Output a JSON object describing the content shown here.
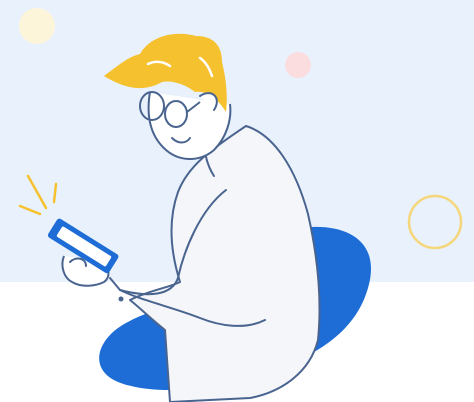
{
  "illustration": {
    "subject": "person-using-phone",
    "colors": {
      "sky": "#E8F1FC",
      "ground": "#FFFFFF",
      "hair": "#F6C12E",
      "shirt": "#F4F6F9",
      "outline": "#4A6490",
      "blob": "#1E6CD6",
      "phone": "#1E6CD6",
      "phone_screen": "#FFFFFF",
      "spark": "#F6C12E",
      "dot_yellow": "#FDF5D9",
      "dot_pink": "#FBDDE0",
      "ring": "#F6D67A"
    }
  }
}
